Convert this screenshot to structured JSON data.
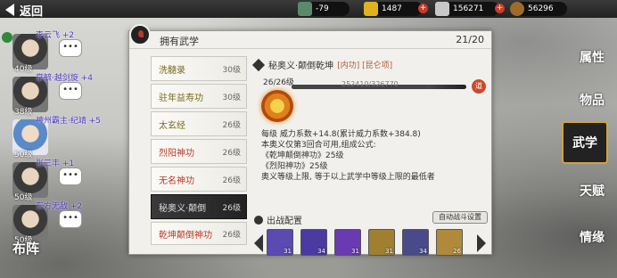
{
  "back_label": "返回",
  "resources": [
    {
      "icon": "scroll-icon",
      "value": "-79",
      "color": "#5a8a6a"
    },
    {
      "icon": "gold-icon",
      "value": "1487",
      "color": "#e0b21e"
    },
    {
      "icon": "silver-icon",
      "value": "156271",
      "color": "#c8c8c8"
    },
    {
      "icon": "coin-icon",
      "value": "56296",
      "color": "#a06a2a"
    }
  ],
  "characters": [
    {
      "name": "李云飞 +2",
      "level": "40级",
      "chat": "•••"
    },
    {
      "name": "掌毓·越剑旋 +4",
      "level": "38级",
      "chat": "•••"
    },
    {
      "name": "神州霸主·纪靖 +5",
      "level": "50级",
      "chat": "•••"
    },
    {
      "name": "张三丰 +1",
      "level": "50级",
      "chat": "•••"
    },
    {
      "name": "东方无敌 +2",
      "level": "50级",
      "chat": "•••"
    }
  ],
  "formation_label": "布阵",
  "panel": {
    "title": "拥有武学",
    "count": "21/20"
  },
  "skills": [
    {
      "name": "洗髓录",
      "level": "30级"
    },
    {
      "name": "驻年益寿功",
      "level": "30级"
    },
    {
      "name": "太玄经",
      "level": "26级"
    },
    {
      "name": "烈阳神功",
      "level": "26级"
    },
    {
      "name": "无名神功",
      "level": "26级"
    },
    {
      "name": "秘奥义·颠倒",
      "level": "26级"
    },
    {
      "name": "乾坤颠倒神功",
      "level": "26级"
    }
  ],
  "detail": {
    "name": "秘奥义·颠倒乾坤",
    "tag": "[内功] [昆仑项]",
    "level": "26/26级",
    "progress_text": "252410/326770",
    "progress": 0.77,
    "lines": [
      "每级  威力系数+14.8(累计威力系数+384.8)",
      "本奥义仅第3回合可用,组成公式:",
      "《乾坤颠倒神功》25级",
      "《烈阳神功》25级",
      "奥义等级上限, 等于以上武学中等级上限的最低者"
    ],
    "battle_label": "出战配置",
    "auto_label": "自动战斗设置"
  },
  "slots": [
    {
      "n": "31",
      "color": "#5a4ab2"
    },
    {
      "n": "34",
      "color": "#4a3aa2"
    },
    {
      "n": "31",
      "color": "#6a3ab2"
    },
    {
      "n": "31",
      "color": "#a08030"
    },
    {
      "n": "34",
      "color": "#4a4a8a"
    },
    {
      "n": "26",
      "color": "#b08a3a"
    }
  ],
  "tabs": [
    {
      "label": "属性",
      "icon": "attribute-icon"
    },
    {
      "label": "物品",
      "icon": "item-icon"
    },
    {
      "label": "武学",
      "icon": "martial-icon"
    },
    {
      "label": "天赋",
      "icon": "talent-icon"
    },
    {
      "label": "情缘",
      "icon": "bond-icon"
    }
  ],
  "selected_tab": 2
}
